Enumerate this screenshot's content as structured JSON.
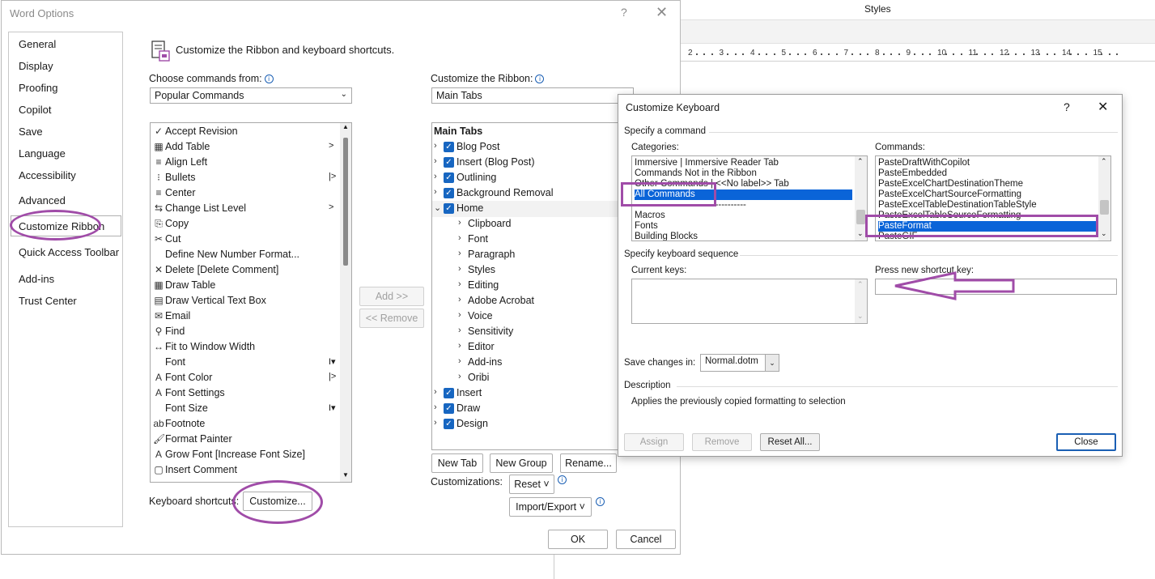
{
  "background": {
    "styles_label": "Styles",
    "ruler_ticks": [
      "2",
      "3",
      "4",
      "5",
      "6",
      "7",
      "8",
      "9",
      "10",
      "11",
      "12",
      "13",
      "14",
      "15"
    ]
  },
  "word_options": {
    "title": "Word Options",
    "help": "?",
    "close": "✕",
    "nav": [
      "General",
      "Display",
      "Proofing",
      "Copilot",
      "Save",
      "Language",
      "Accessibility",
      "Advanced",
      "Customize Ribbon",
      "Quick Access Toolbar",
      "Add-ins",
      "Trust Center"
    ],
    "header": "Customize the Ribbon and keyboard shortcuts.",
    "choose_label": "Choose commands from:",
    "choose_value": "Popular Commands",
    "ribbon_label": "Customize the Ribbon:",
    "ribbon_value": "Main Tabs",
    "commands": [
      {
        "icon": "accept-icon",
        "glyph": "✓",
        "text": "Accept Revision",
        "arrow": ""
      },
      {
        "icon": "table-icon",
        "glyph": "▦",
        "text": "Add Table",
        "arrow": ">"
      },
      {
        "icon": "align-left-icon",
        "glyph": "≡",
        "text": "Align Left",
        "arrow": ""
      },
      {
        "icon": "bullets-icon",
        "glyph": "⁝",
        "text": "Bullets",
        "arrow": "|>"
      },
      {
        "icon": "center-icon",
        "glyph": "≡",
        "text": "Center",
        "arrow": ""
      },
      {
        "icon": "list-level-icon",
        "glyph": "⇆",
        "text": "Change List Level",
        "arrow": ">"
      },
      {
        "icon": "copy-icon",
        "glyph": "⎘",
        "text": "Copy",
        "arrow": ""
      },
      {
        "icon": "cut-icon",
        "glyph": "✂",
        "text": "Cut",
        "arrow": ""
      },
      {
        "icon": "",
        "glyph": "",
        "text": "Define New Number Format...",
        "arrow": ""
      },
      {
        "icon": "delete-comment-icon",
        "glyph": "✕",
        "text": "Delete [Delete Comment]",
        "arrow": ""
      },
      {
        "icon": "draw-table-icon",
        "glyph": "▦",
        "text": "Draw Table",
        "arrow": ""
      },
      {
        "icon": "text-box-icon",
        "glyph": "▤",
        "text": "Draw Vertical Text Box",
        "arrow": ""
      },
      {
        "icon": "email-icon",
        "glyph": "✉",
        "text": "Email",
        "arrow": ""
      },
      {
        "icon": "find-icon",
        "glyph": "⚲",
        "text": "Find",
        "arrow": ""
      },
      {
        "icon": "fit-width-icon",
        "glyph": "↔",
        "text": "Fit to Window Width",
        "arrow": ""
      },
      {
        "icon": "",
        "glyph": "",
        "text": "Font",
        "arrow": "I▾"
      },
      {
        "icon": "font-color-icon",
        "glyph": "A",
        "text": "Font Color",
        "arrow": "|>"
      },
      {
        "icon": "font-settings-icon",
        "glyph": "A",
        "text": "Font Settings",
        "arrow": ""
      },
      {
        "icon": "",
        "glyph": "",
        "text": "Font Size",
        "arrow": "I▾"
      },
      {
        "icon": "footnote-icon",
        "glyph": "ab",
        "text": "Footnote",
        "arrow": ""
      },
      {
        "icon": "format-painter-icon",
        "glyph": "🖌",
        "text": "Format Painter",
        "arrow": ""
      },
      {
        "icon": "grow-font-icon",
        "glyph": "A",
        "text": "Grow Font [Increase Font Size]",
        "arrow": ""
      },
      {
        "icon": "insert-comment-icon",
        "glyph": "▢",
        "text": "Insert Comment",
        "arrow": ""
      }
    ],
    "add_button": "Add >>",
    "remove_button": "<< Remove",
    "tree": [
      {
        "level": 0,
        "exp": "",
        "check": false,
        "text": "Main Tabs",
        "bold": true
      },
      {
        "level": 0,
        "exp": "›",
        "check": true,
        "text": "Blog Post"
      },
      {
        "level": 0,
        "exp": "›",
        "check": true,
        "text": "Insert (Blog Post)"
      },
      {
        "level": 0,
        "exp": "›",
        "check": true,
        "text": "Outlining"
      },
      {
        "level": 0,
        "exp": "›",
        "check": true,
        "text": "Background Removal"
      },
      {
        "level": 0,
        "exp": "⌄",
        "check": true,
        "text": "Home"
      },
      {
        "level": 1,
        "exp": "›",
        "check": false,
        "text": "Clipboard"
      },
      {
        "level": 1,
        "exp": "›",
        "check": false,
        "text": "Font"
      },
      {
        "level": 1,
        "exp": "›",
        "check": false,
        "text": "Paragraph"
      },
      {
        "level": 1,
        "exp": "›",
        "check": false,
        "text": "Styles"
      },
      {
        "level": 1,
        "exp": "›",
        "check": false,
        "text": "Editing"
      },
      {
        "level": 1,
        "exp": "›",
        "check": false,
        "text": "Adobe Acrobat"
      },
      {
        "level": 1,
        "exp": "›",
        "check": false,
        "text": "Voice"
      },
      {
        "level": 1,
        "exp": "›",
        "check": false,
        "text": "Sensitivity"
      },
      {
        "level": 1,
        "exp": "›",
        "check": false,
        "text": "Editor"
      },
      {
        "level": 1,
        "exp": "›",
        "check": false,
        "text": "Add-ins"
      },
      {
        "level": 1,
        "exp": "›",
        "check": false,
        "text": "Oribi"
      },
      {
        "level": 0,
        "exp": "›",
        "check": true,
        "text": "Insert"
      },
      {
        "level": 0,
        "exp": "›",
        "check": true,
        "text": "Draw"
      },
      {
        "level": 0,
        "exp": "›",
        "check": true,
        "text": "Design"
      }
    ],
    "new_tab": "New Tab",
    "new_group": "New Group",
    "rename": "Rename...",
    "customizations_label": "Customizations:",
    "reset": "Reset ˅",
    "import_export": "Import/Export ˅",
    "keyboard_label": "Keyboard shortcuts:",
    "customize_button": "Customize...",
    "ok": "OK",
    "cancel": "Cancel"
  },
  "customize_keyboard": {
    "title": "Customize Keyboard",
    "help": "?",
    "close": "✕",
    "specify_command": "Specify a command",
    "categories_label": "Categories:",
    "categories": [
      "Immersive | Immersive Reader Tab",
      "Commands Not in the Ribbon",
      "Other Commands | <<No label>> Tab",
      "All Commands",
      "------------------------------------",
      "Macros",
      "Fonts",
      "Building Blocks"
    ],
    "commands_label": "Commands:",
    "commands": [
      "PasteDraftWithCopilot",
      "PasteEmbedded",
      "PasteExcelChartDestinationTheme",
      "PasteExcelChartSourceFormatting",
      "PasteExcelTableDestinationTableStyle",
      "PasteExcelTableSourceFormatting",
      "PasteFormat",
      "PasteGIF"
    ],
    "specify_sequence": "Specify keyboard sequence",
    "current_keys_label": "Current keys:",
    "press_new_label": "Press new shortcut key:",
    "save_changes_label": "Save changes in:",
    "save_changes_value": "Normal.dotm",
    "description_label": "Description",
    "description_text": "Applies the previously copied formatting to selection",
    "assign": "Assign",
    "remove": "Remove",
    "reset_all": "Reset All...",
    "close_button": "Close"
  },
  "annotation_color": "#a04ca8"
}
